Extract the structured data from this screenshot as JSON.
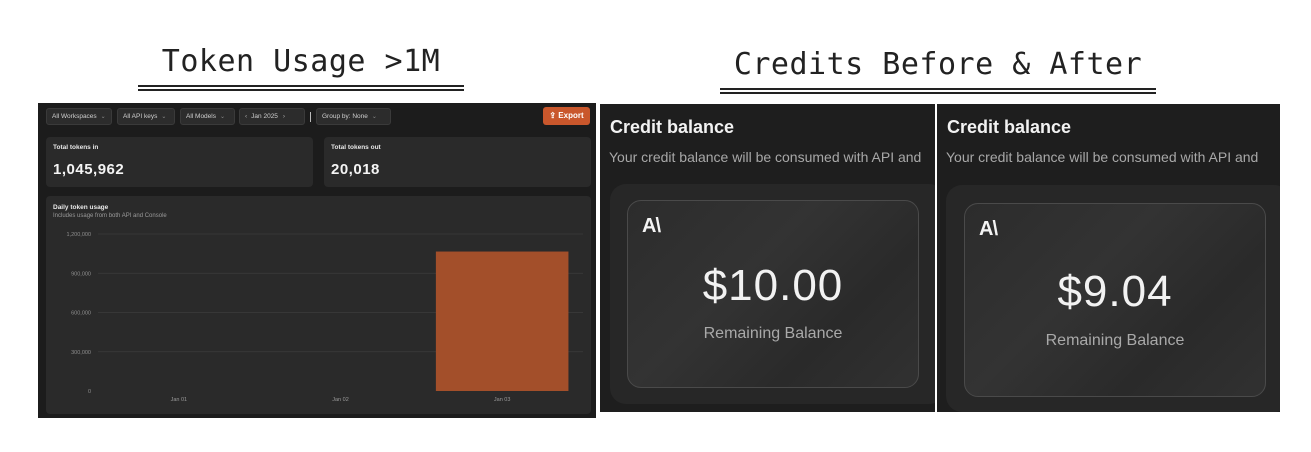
{
  "headings": {
    "left": "Token Usage >1M",
    "right": "Credits Before & After"
  },
  "dashboard": {
    "filters": {
      "workspaces": "All Workspaces",
      "api_keys": "All API keys",
      "models": "All Models",
      "date": "Jan 2025",
      "group_by": "Group by: None"
    },
    "export_label": "Export",
    "tokens_in": {
      "label": "Total tokens in",
      "value": "1,045,962"
    },
    "tokens_out": {
      "label": "Total tokens out",
      "value": "20,018"
    },
    "chart": {
      "title": "Daily token usage",
      "subtitle": "Includes usage from both API and Console"
    }
  },
  "chart_data": {
    "type": "bar",
    "categories": [
      "Jan 01",
      "Jan 02",
      "Jan 03"
    ],
    "values": [
      0,
      0,
      1065980
    ],
    "title": "Daily token usage",
    "ylim": [
      0,
      1200000
    ],
    "yticks": [
      0,
      300000,
      600000,
      900000,
      1200000
    ],
    "ytick_labels": [
      "0",
      "300,000",
      "600,000",
      "900,000",
      "1,200,000"
    ],
    "grid": true,
    "bar_color": "#a34f2a"
  },
  "credits": [
    {
      "title": "Credit balance",
      "description": "Your credit balance will be consumed with API and",
      "logo": "A\\",
      "amount": "$10.00",
      "amount_label": "Remaining Balance"
    },
    {
      "title": "Credit balance",
      "description": "Your credit balance will be consumed with API and",
      "logo": "A\\",
      "amount": "$9.04",
      "amount_label": "Remaining Balance"
    }
  ],
  "colors": {
    "accent": "#c9572c",
    "panel_bg": "#1c1c1c",
    "card_bg": "#2a2a2a"
  }
}
